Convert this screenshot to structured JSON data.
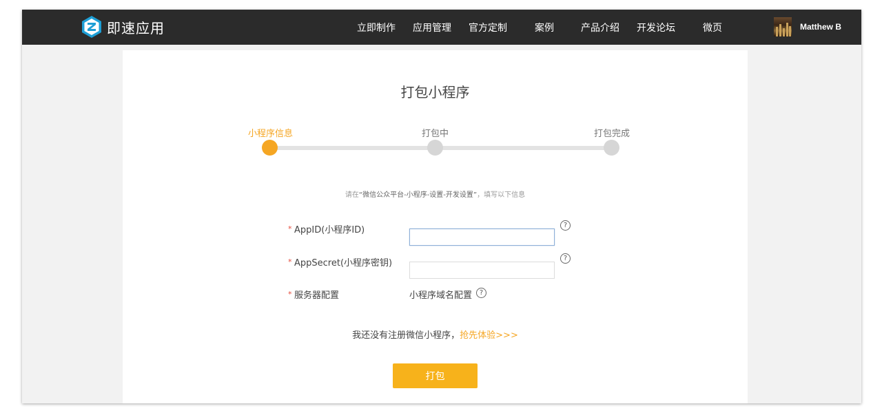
{
  "brand": {
    "name": "即速应用",
    "color": "#1e9fd6"
  },
  "nav": {
    "items": [
      {
        "label": "立即制作"
      },
      {
        "label": "应用管理"
      },
      {
        "label": "官方定制"
      },
      {
        "label": "案例"
      },
      {
        "label": "产品介绍"
      },
      {
        "label": "开发论坛"
      },
      {
        "label": "微页"
      }
    ]
  },
  "user": {
    "name": "Matthew B"
  },
  "page": {
    "title": "打包小程序",
    "steps": [
      {
        "label": "小程序信息",
        "state": "active"
      },
      {
        "label": "打包中",
        "state": "pending"
      },
      {
        "label": "打包完成",
        "state": "pending"
      }
    ],
    "hint": {
      "before": "请在",
      "highlight": "“微信公众平台-小程序-设置-开发设置”",
      "after": "，填写以下信息"
    }
  },
  "form": {
    "required_mark": "*",
    "appid": {
      "label": "AppID(小程序ID)",
      "value": "",
      "placeholder": ""
    },
    "appsecret": {
      "label": "AppSecret(小程序密钥)",
      "value": "",
      "placeholder": ""
    },
    "server": {
      "label": "服务器配置",
      "value": "小程序域名配置"
    },
    "help_glyph": "?"
  },
  "register": {
    "text": "我还没有注册微信小程序，",
    "link": "抢先体验>>>"
  },
  "actions": {
    "pack_label": "打包"
  },
  "colors": {
    "accent": "#f5a623",
    "button": "#f7b21b",
    "topbar": "#2b2b2b",
    "required": "#e64c3c"
  }
}
